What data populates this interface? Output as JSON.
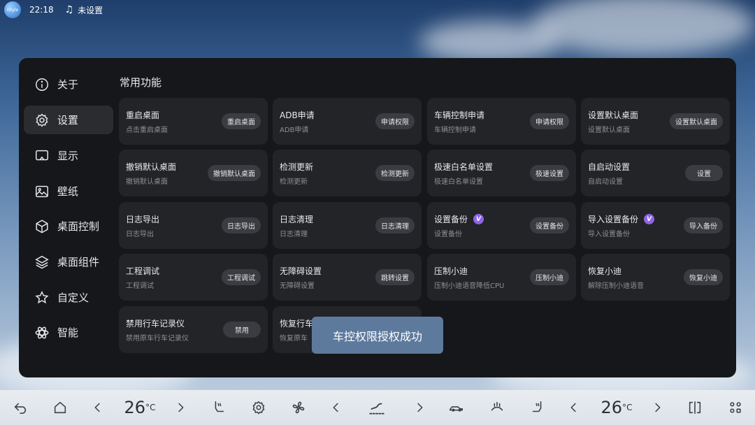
{
  "status_bar": {
    "logo_text": "iStyle",
    "time": "22:18",
    "music_status": "未设置"
  },
  "nav": {
    "items": [
      {
        "label": "关于",
        "icon": "info-icon"
      },
      {
        "label": "设置",
        "icon": "gear-icon",
        "active": true
      },
      {
        "label": "显示",
        "icon": "display-icon"
      },
      {
        "label": "壁纸",
        "icon": "image-icon"
      },
      {
        "label": "桌面控制",
        "icon": "cube-icon"
      },
      {
        "label": "桌面组件",
        "icon": "layers-icon"
      },
      {
        "label": "自定义",
        "icon": "star-icon"
      },
      {
        "label": "智能",
        "icon": "atom-icon"
      }
    ]
  },
  "section_title": "常用功能",
  "cards": [
    {
      "title": "重启桌面",
      "sub": "点击重启桌面",
      "btn": "重启桌面"
    },
    {
      "title": "ADB申请",
      "sub": "ADB申请",
      "btn": "申请权限"
    },
    {
      "title": "车辆控制申请",
      "sub": "车辆控制申请",
      "btn": "申请权限"
    },
    {
      "title": "设置默认桌面",
      "sub": "设置默认桌面",
      "btn": "设置默认桌面"
    },
    {
      "title": "撤销默认桌面",
      "sub": "撤销默认桌面",
      "btn": "撤销默认桌面"
    },
    {
      "title": "检测更新",
      "sub": "检测更新",
      "btn": "检测更新"
    },
    {
      "title": "极速白名单设置",
      "sub": "极速白名单设置",
      "btn": "极速设置"
    },
    {
      "title": "自启动设置",
      "sub": "自启动设置",
      "btn": "设置"
    },
    {
      "title": "日志导出",
      "sub": "日志导出",
      "btn": "日志导出"
    },
    {
      "title": "日志清理",
      "sub": "日志清理",
      "btn": "日志清理"
    },
    {
      "title": "设置备份",
      "sub": "设置备份",
      "btn": "设置备份",
      "vip": "V"
    },
    {
      "title": "导入设置备份",
      "sub": "导入设置备份",
      "btn": "导入备份",
      "vip": "V"
    },
    {
      "title": "工程调试",
      "sub": "工程调试",
      "btn": "工程调试"
    },
    {
      "title": "无障碍设置",
      "sub": "无障碍设置",
      "btn": "跳转设置"
    },
    {
      "title": "压制小迪",
      "sub": "压制小迪语音降低CPU",
      "btn": "压制小迪"
    },
    {
      "title": "恢复小迪",
      "sub": "解除压制小迪语音",
      "btn": "恢复小迪"
    },
    {
      "title": "禁用行车记录仪",
      "sub": "禁用原车行车记录仪",
      "btn": "禁用"
    },
    {
      "title": "恢复行车",
      "sub": "恢复原车",
      "btn": ""
    }
  ],
  "toast": "车控权限授权成功",
  "dock": {
    "left_temp": "26",
    "right_temp": "26",
    "temp_unit": "°C"
  }
}
